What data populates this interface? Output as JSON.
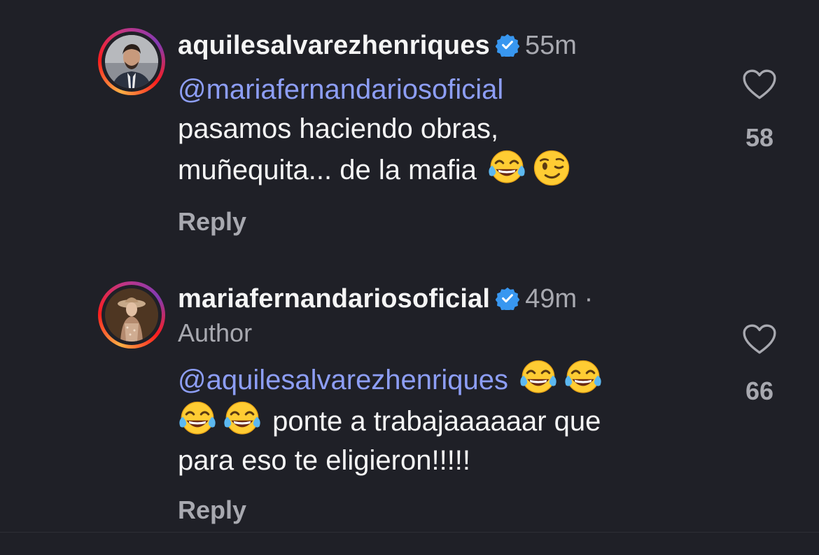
{
  "comments": [
    {
      "username": "aquilesalvarezhenriques",
      "time": "55m",
      "mention": "@mariafernandariosoficial",
      "text_line1": "pasamos haciendo obras,",
      "text_line2": "muñequita... de la mafia",
      "emojis": [
        "face-with-tears-of-joy",
        "winking-face"
      ],
      "reply_label": "Reply",
      "like_count": "58",
      "verified": true
    },
    {
      "username": "mariafernandariosoficial",
      "time": "49m ·",
      "author_label": "Author",
      "mention": "@aquilesalvarezhenriques",
      "text_line2": "ponte a trabajaaaaaar que",
      "text_line3": "para eso te eligieron!!!!!",
      "emojis": [
        "face-with-tears-of-joy",
        "face-with-tears-of-joy",
        "face-with-tears-of-joy",
        "face-with-tears-of-joy"
      ],
      "reply_label": "Reply",
      "like_count": "66",
      "verified": true
    }
  ],
  "colors": {
    "background": "#1f2027",
    "mention": "#8d9ef6",
    "secondary_text": "#a8a9b0",
    "verified_badge": "#3897f0"
  }
}
